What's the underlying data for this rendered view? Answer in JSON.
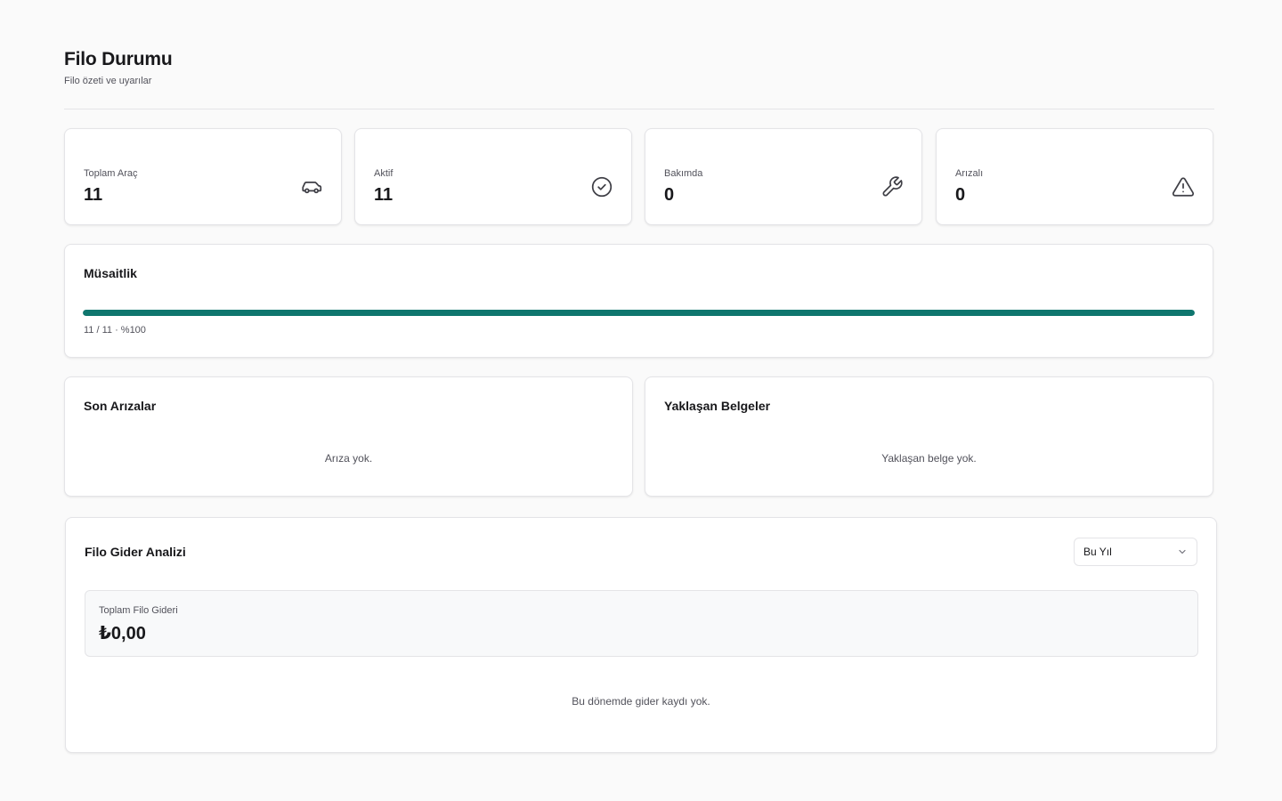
{
  "header": {
    "title": "Filo Durumu",
    "subtitle": "Filo özeti ve uyarılar"
  },
  "stats": [
    {
      "label": "Toplam Araç",
      "value": "11",
      "icon": "car-icon"
    },
    {
      "label": "Aktif",
      "value": "11",
      "icon": "check-circle-icon"
    },
    {
      "label": "Bakımda",
      "value": "0",
      "icon": "wrench-icon"
    },
    {
      "label": "Arızalı",
      "value": "0",
      "icon": "warning-triangle-icon"
    }
  ],
  "availability": {
    "title": "Müsaitlik",
    "summary": "11 / 11 · %100",
    "fraction": 1.0,
    "bar_color": "#0f766e"
  },
  "recent_faults": {
    "title": "Son Arızalar",
    "empty": "Arıza yok."
  },
  "upcoming_documents": {
    "title": "Yaklaşan Belgeler",
    "empty": "Yaklaşan belge yok."
  },
  "expense": {
    "title": "Filo Gider Analizi",
    "period_selected": "Bu Yıl",
    "total_label": "Toplam Filo Gideri",
    "total_value": "₺0,00",
    "empty": "Bu dönemde gider kaydı yok."
  }
}
